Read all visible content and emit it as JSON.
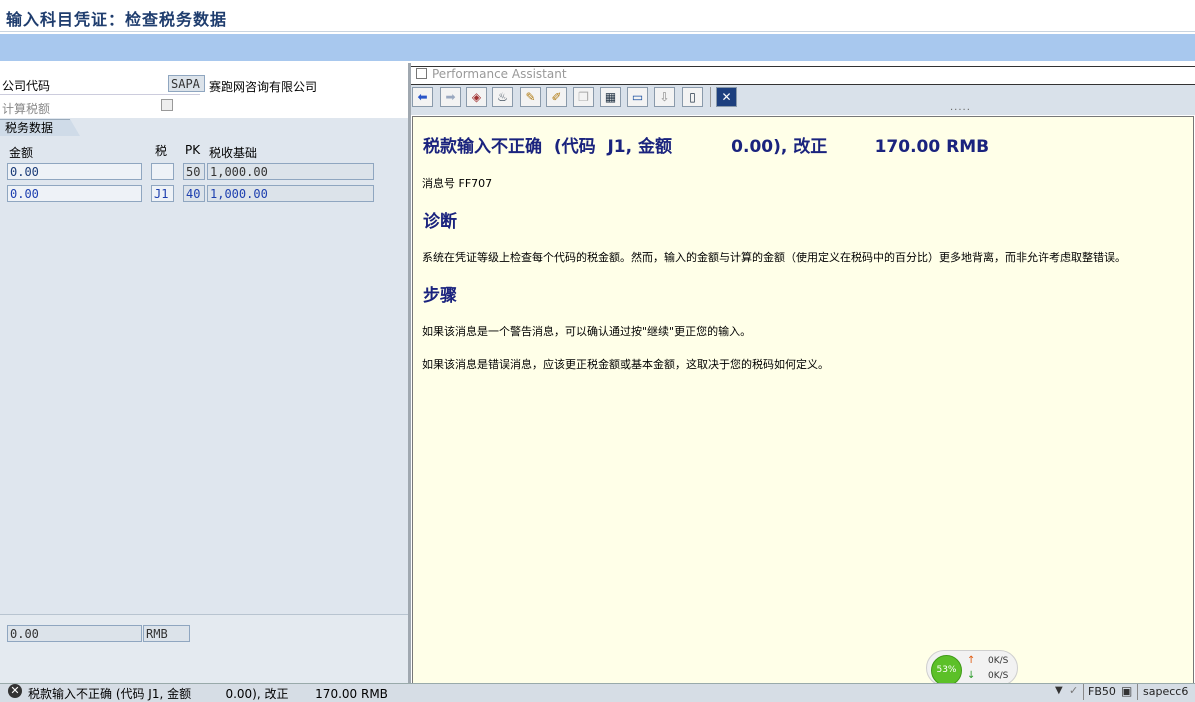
{
  "window": {
    "title": "输入科目凭证：检查税务数据"
  },
  "header_fields": {
    "company_code_label": "公司代码",
    "company_code_value": "SAPA",
    "company_name": "赛跑网咨询有限公司",
    "calc_tax_label": "计算税额"
  },
  "tax_tab": {
    "label": "税务数据"
  },
  "tax_table": {
    "columns": {
      "amount": "金额",
      "tax": "税",
      "pk": "PK",
      "base": "税收基础"
    },
    "rows": [
      {
        "amount": "0.00",
        "tax": "",
        "pk": "50",
        "base": "1,000.00"
      },
      {
        "amount": "0.00",
        "tax": "J1",
        "pk": "40",
        "base": "1,000.00"
      }
    ]
  },
  "footer_fields": {
    "amount": "0.00",
    "currency": "RMB"
  },
  "performance_assistant": {
    "title": "Performance Assistant",
    "toolbar_icons": [
      "back-arrow-icon",
      "forward-arrow-icon",
      "tech-info-icon",
      "settings-icon",
      "edit-icon",
      "glossary-icon",
      "print-preview-icon",
      "table-icon",
      "display-icon",
      "expand-icon",
      "print-icon",
      "close-icon"
    ],
    "heading": "税款输入不正确  (代码  J1, 金额          0.00), 改正        170.00 RMB",
    "message_no": "消息号  FF707",
    "diag_title": "诊断",
    "diag_text": "系统在凭证等级上检查每个代码的税金额。然而，输入的金额与计算的金额（使用定义在税码中的百分比）更多地背离，而非允许考虑取整错误。",
    "steps_title": "步骤",
    "step1": "如果该消息是一个警告消息，可以确认通过按\"继续\"更正您的输入。",
    "step2": "如果该消息是错误消息，应该更正税金额或基本金额，这取决于您的税码如何定义。"
  },
  "status_bar": {
    "message": "税款输入不正确 (代码 J1, 金额         0.00), 改正       170.00 RMB",
    "transaction": "FB50",
    "server": "sapecc6"
  },
  "net_widget": {
    "percent": "53%",
    "up": "0K/S",
    "down": "0K/S"
  },
  "colors": {
    "accent": "#1a237e",
    "band": "#a8c8ee",
    "pane_bg": "#ffffe8"
  }
}
